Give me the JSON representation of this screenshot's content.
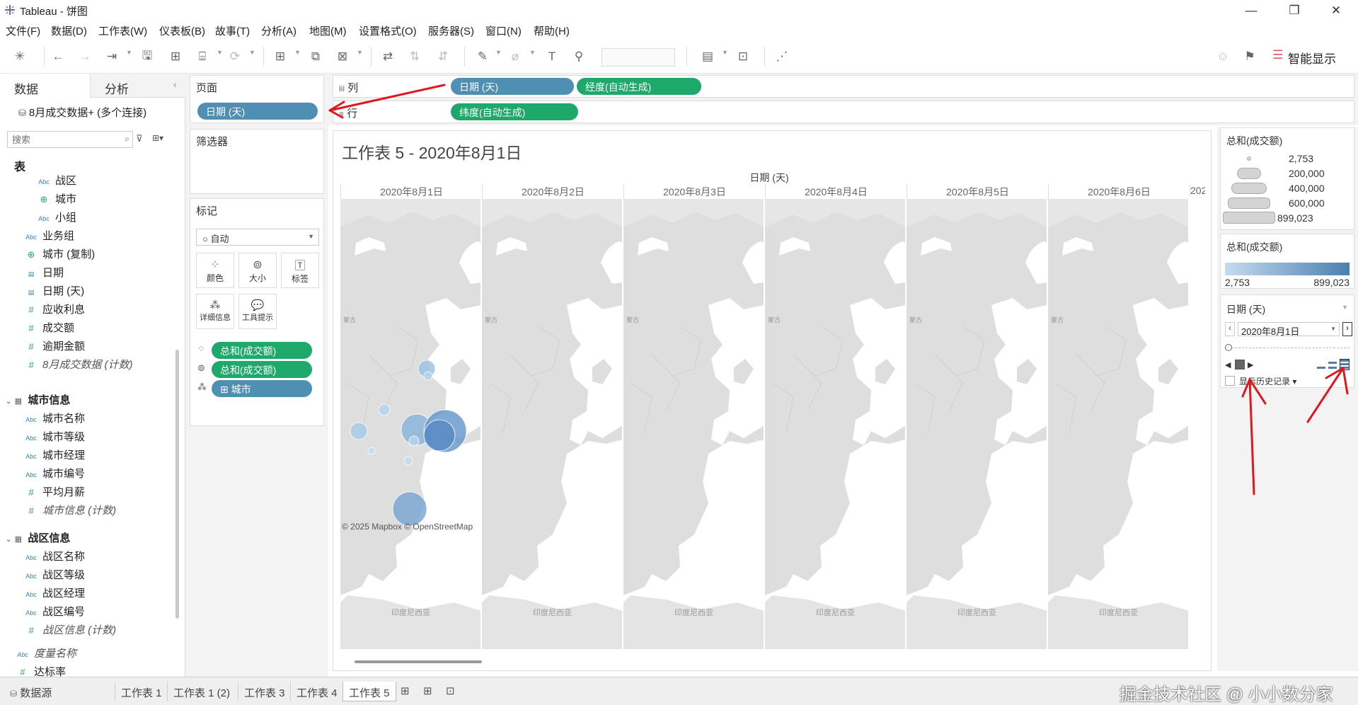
{
  "app": {
    "title": "Tableau - 饼图"
  },
  "menu": [
    "文件(F)",
    "数据(D)",
    "工作表(W)",
    "仪表板(B)",
    "故事(T)",
    "分析(A)",
    "地图(M)",
    "设置格式(O)",
    "服务器(S)",
    "窗口(N)",
    "帮助(H)"
  ],
  "toolbar": {
    "smart_show": "智能显示"
  },
  "data_pane": {
    "tabs": [
      "数据",
      "分析"
    ],
    "connection": "8月成交数据+ (多个连接)",
    "search_placeholder": "搜索",
    "tables_header": "表",
    "fields": [
      {
        "name": "战区",
        "type": "Abc",
        "indent": 2
      },
      {
        "name": "城市",
        "type": "globe",
        "indent": 2
      },
      {
        "name": "小组",
        "type": "Abc",
        "indent": 2
      },
      {
        "name": "业务组",
        "type": "Abc",
        "indent": 1
      },
      {
        "name": "城市 (复制)",
        "type": "globe",
        "indent": 1
      },
      {
        "name": "日期",
        "type": "date",
        "indent": 1
      },
      {
        "name": "日期 (天)",
        "type": "date",
        "indent": 1
      },
      {
        "name": "应收利息",
        "type": "#",
        "indent": 1
      },
      {
        "name": "成交额",
        "type": "#",
        "indent": 1
      },
      {
        "name": "逾期金额",
        "type": "#",
        "indent": 1
      },
      {
        "name": "8月成交数据 (计数)",
        "type": "#",
        "indent": 1,
        "italic": true
      }
    ],
    "group1": {
      "name": "城市信息",
      "fields": [
        {
          "name": "城市名称",
          "type": "Abc"
        },
        {
          "name": "城市等级",
          "type": "Abc"
        },
        {
          "name": "城市经理",
          "type": "Abc"
        },
        {
          "name": "城市编号",
          "type": "Abc"
        },
        {
          "name": "平均月薪",
          "type": "#"
        },
        {
          "name": "城市信息 (计数)",
          "type": "#",
          "italic": true
        }
      ]
    },
    "group2": {
      "name": "战区信息",
      "fields": [
        {
          "name": "战区名称",
          "type": "Abc"
        },
        {
          "name": "战区等级",
          "type": "Abc"
        },
        {
          "name": "战区经理",
          "type": "Abc"
        },
        {
          "name": "战区编号",
          "type": "Abc"
        },
        {
          "name": "战区信息 (计数)",
          "type": "#",
          "italic": true
        }
      ]
    },
    "measure_names": "度量名称",
    "more": "达标率"
  },
  "cards": {
    "pages": {
      "title": "页面",
      "pill": "日期 (天)"
    },
    "filters": {
      "title": "筛选器"
    },
    "marks": {
      "title": "标记",
      "type": "自动",
      "buttons": [
        "颜色",
        "大小",
        "标签",
        "详细信息",
        "工具提示"
      ],
      "pills": [
        "总和(成交额)",
        "总和(成交额)",
        "城市"
      ]
    }
  },
  "shelves": {
    "columns": {
      "label": "列",
      "pills": [
        "日期 (天)",
        "经度(自动生成)"
      ]
    },
    "rows": {
      "label": "行",
      "pills": [
        "纬度(自动生成)"
      ]
    }
  },
  "view": {
    "title": "工作表 5 - 2020年8月1日",
    "header_title": "日期 (天)",
    "columns": [
      "2020年8月1日",
      "2020年8月2日",
      "2020年8月3日",
      "2020年8月4日",
      "2020年8月5日",
      "2020年8月6日",
      "202"
    ],
    "map_labels": {
      "mongolia": "蒙古",
      "indonesia": "印度尼西亚"
    },
    "attribution": "© 2025 Mapbox © OpenStreetMap"
  },
  "legends": {
    "size": {
      "title": "总和(成交额)",
      "items": [
        "2,753",
        "200,000",
        "400,000",
        "600,000",
        "899,023"
      ]
    },
    "color": {
      "title": "总和(成交额)",
      "min": "2,753",
      "max": "899,023",
      "gradient_from": "#c6dbef",
      "gradient_to": "#4a7fb0"
    },
    "pages": {
      "title": "日期 (天)",
      "current": "2020年8月1日",
      "show_history": "显示历史记录"
    }
  },
  "bottom_tabs": [
    "数据源",
    "工作表 1",
    "工作表 1 (2)",
    "工作表 3",
    "工作表 4",
    "工作表 5"
  ],
  "active_tab": "工作表 5",
  "watermark": "掘金技术社区 @ 小小数分家",
  "colors": {
    "pill_blue": "#4f8fb4",
    "pill_green": "#1ea86a",
    "annotation_red": "#e0171f"
  }
}
